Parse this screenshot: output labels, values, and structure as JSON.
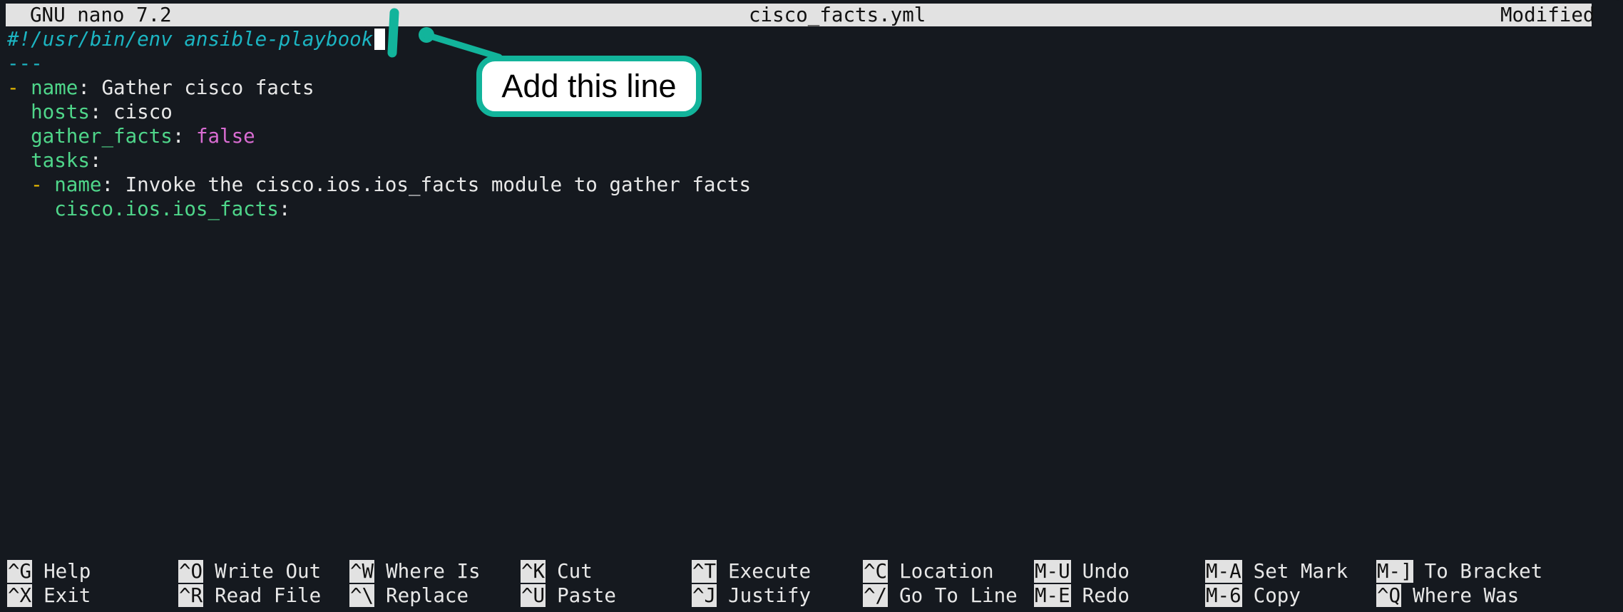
{
  "titlebar": {
    "app": "GNU nano 7.2",
    "filename": "cisco_facts.yml",
    "status": "Modified"
  },
  "editor": {
    "shebang": "#!/usr/bin/env ansible-playbook",
    "separator": "---",
    "line3_dash": "- ",
    "line3_key": "name",
    "line3_colon": ": ",
    "line3_value": "Gather cisco facts",
    "line4_key": "hosts",
    "line4_colon": ": ",
    "line4_value": "cisco",
    "line5_key": "gather_facts",
    "line5_colon": ": ",
    "line5_value": "false",
    "line6_key": "tasks",
    "line6_colon": ":",
    "line7_dash": "- ",
    "line7_key": "name",
    "line7_colon": ": ",
    "line7_value": "Invoke the cisco.ios.ios_facts module to gather facts",
    "line8_key": "cisco.ios.ios_facts",
    "line8_colon": ":"
  },
  "callout": {
    "text": "Add this line"
  },
  "shortcuts": [
    {
      "key": "^G",
      "label": "Help"
    },
    {
      "key": "^O",
      "label": "Write Out"
    },
    {
      "key": "^W",
      "label": "Where Is"
    },
    {
      "key": "^K",
      "label": "Cut"
    },
    {
      "key": "^T",
      "label": "Execute"
    },
    {
      "key": "^C",
      "label": "Location"
    },
    {
      "key": "M-U",
      "label": "Undo"
    },
    {
      "key": "M-A",
      "label": "Set Mark"
    },
    {
      "key": "M-]",
      "label": "To Bracket"
    },
    {
      "key": "^X",
      "label": "Exit"
    },
    {
      "key": "^R",
      "label": "Read File"
    },
    {
      "key": "^\\",
      "label": "Replace"
    },
    {
      "key": "^U",
      "label": "Paste"
    },
    {
      "key": "^J",
      "label": "Justify"
    },
    {
      "key": "^/",
      "label": "Go To Line"
    },
    {
      "key": "M-E",
      "label": "Redo"
    },
    {
      "key": "M-6",
      "label": "Copy"
    },
    {
      "key": "^Q",
      "label": "Where Was"
    }
  ],
  "colors": {
    "background": "#15191f",
    "bar": "#e2e2e2",
    "comment": "#1cb5c2",
    "key": "#4fd68a",
    "dash": "#e5b800",
    "boolean": "#d96cd2",
    "callout_border": "#12b49b"
  }
}
